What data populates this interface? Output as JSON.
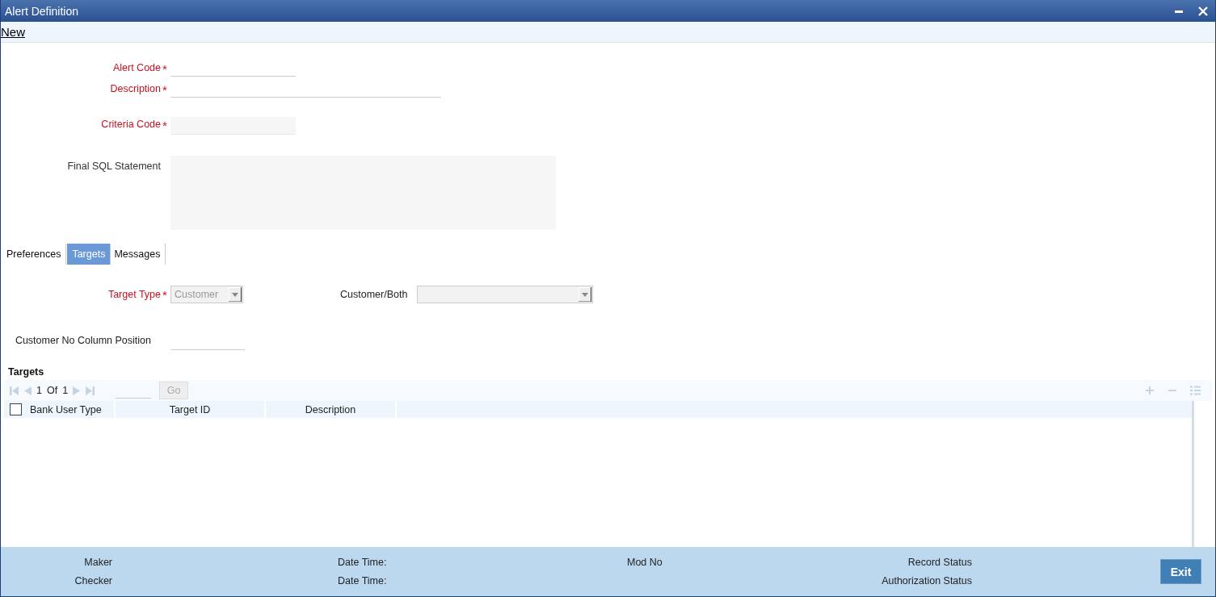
{
  "window": {
    "title": "Alert Definition"
  },
  "toolbar": {
    "new_link": "New"
  },
  "fields": [
    {
      "kind": "input",
      "label": "Alert Code",
      "required": true,
      "required_mark": "*"
    },
    {
      "kind": "input",
      "label": "Description",
      "required": true,
      "required_mark": "*"
    },
    {
      "kind": "readonly",
      "label": "Criteria Code",
      "required": true,
      "required_mark": "*"
    },
    {
      "kind": "textarea",
      "label": "Final SQL Statement",
      "required": false
    }
  ],
  "tabs": [
    {
      "label": "Preferences",
      "selected": false
    },
    {
      "label": "Targets",
      "selected": true
    },
    {
      "label": "Messages",
      "selected": false
    }
  ],
  "target_type": {
    "label": "Target Type",
    "required": true,
    "required_mark": "*",
    "value": "Customer"
  },
  "customer_both": {
    "label": "Customer/Both"
  },
  "customer_no_column_position": {
    "label": "Customer No Column Position"
  },
  "targets": {
    "title": "Targets",
    "pager": {
      "page": "1",
      "of": "Of",
      "total": "1",
      "go": "Go"
    },
    "select_all_checked": false,
    "columns": [
      "Bank User Type",
      "Target ID",
      "Description"
    ]
  },
  "footer": {
    "left": [
      {
        "label": "Maker",
        "value": "Date Time:"
      },
      {
        "label": "Checker",
        "value": "Date Time:"
      }
    ],
    "mod_no": "Mod No",
    "statuses": [
      "Record Status",
      "Authorization Status"
    ],
    "exit": "Exit"
  }
}
